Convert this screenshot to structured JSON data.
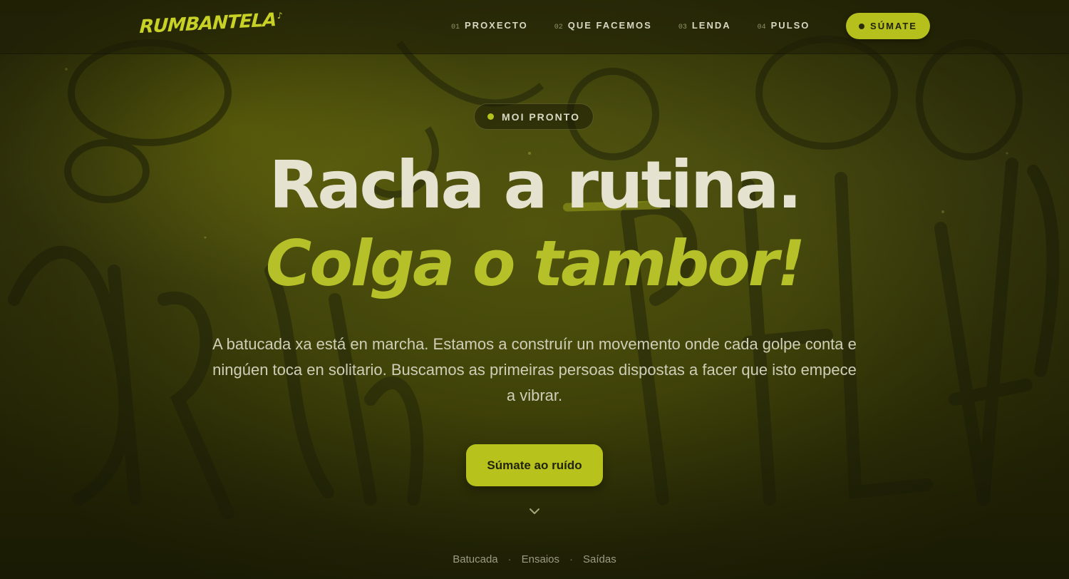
{
  "brand": {
    "logo_text": "RUMBANTELA",
    "logo_mark": "♪"
  },
  "nav": {
    "items": [
      {
        "num": "01",
        "label": "PROXECTO"
      },
      {
        "num": "02",
        "label": "QUE FACEMOS"
      },
      {
        "num": "03",
        "label": "LENDA"
      },
      {
        "num": "04",
        "label": "PULSO"
      }
    ],
    "cta_label": "SÚMATE"
  },
  "hero": {
    "badge": "MOI PRONTO",
    "title_line1": "Racha a rutina.",
    "title_line2": "Colga o tambor!",
    "lead": "A batucada xa está en marcha. Estamos a construír un movemento onde cada golpe conta e ningúen toca en solitario. Buscamos as primeiras persoas dispostas a facer que isto empece a vibrar.",
    "cta_label": "Súmate ao ruído",
    "tags": [
      "Batucada",
      "Ensaios",
      "Saídas"
    ],
    "tag_separator": "·"
  },
  "colors": {
    "accent": "#b7c21d",
    "background": "#3a3c0b",
    "title_text": "#e5e3cf"
  },
  "icons": {
    "scroll_indicator": "chevron-down-icon",
    "badge_dot": "status-dot-icon"
  }
}
